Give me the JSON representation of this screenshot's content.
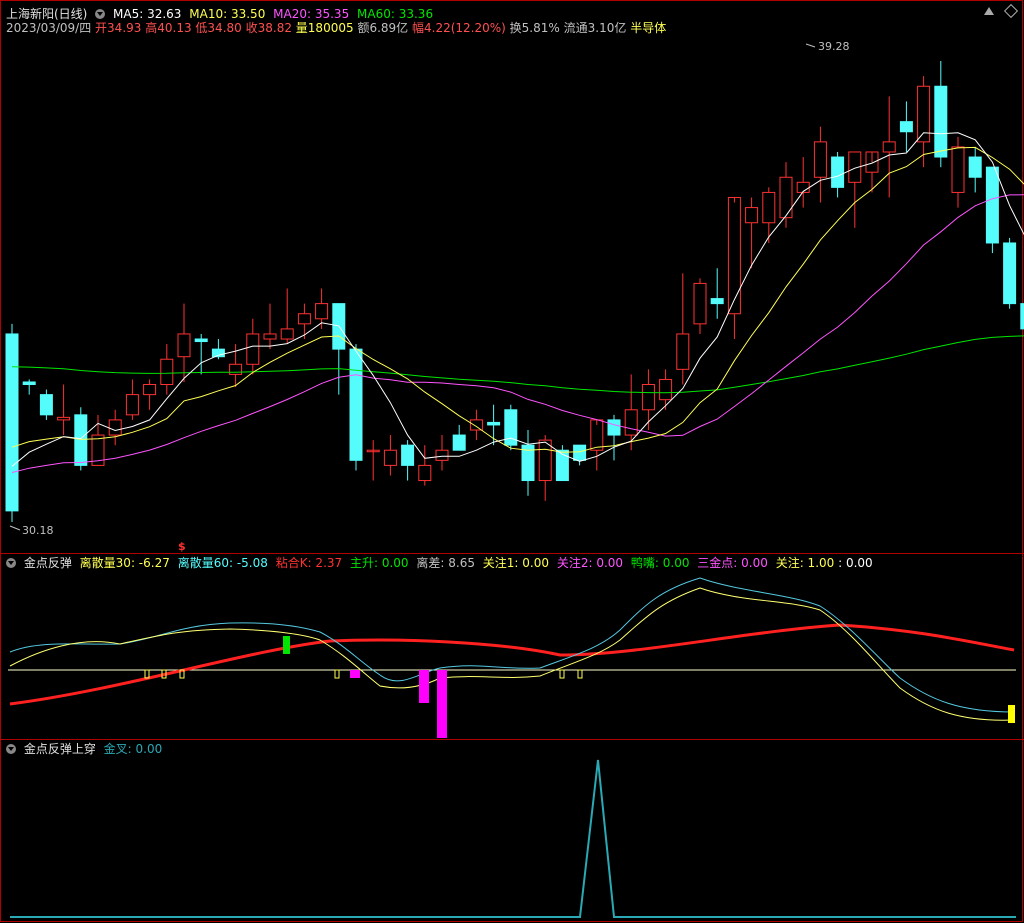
{
  "header": {
    "title": "上海新阳(日线)",
    "ma5": "MA5: 32.63",
    "ma10": "MA10: 33.50",
    "ma20": "MA20: 35.35",
    "ma60": "MA60: 33.36",
    "date": "2023/03/09/四",
    "open": "开34.93",
    "high": "高40.13",
    "low": "低34.80",
    "close": "收38.82",
    "volume": "量180005",
    "amount": "额6.89亿",
    "change": "幅4.22(12.20%)",
    "turnover": "换5.81%",
    "float": "流通3.10亿",
    "sector": "半导体"
  },
  "panel2": {
    "title": "金点反弹",
    "items": [
      "离散量30: -6.27",
      "离散量60: -5.08",
      "粘合K: 2.37",
      "主升: 0.00",
      "离差: 8.65",
      "关注1: 0.00",
      "关注2: 0.00",
      "鸭嘴: 0.00",
      "三金点: 0.00",
      "关注: 1.00",
      ": 0.00"
    ]
  },
  "panel3": {
    "title": "金点反弹上穿",
    "item": "金叉: 0.00"
  },
  "markers": {
    "high_label": "39.28",
    "low_label": "30.18",
    "signal": "$"
  },
  "colors": {
    "up": "#ff3232",
    "down": "#54fcfc",
    "ma5": "#ffffff",
    "ma10": "#ffff54",
    "ma20": "#ff54ff",
    "ma60": "#00e600",
    "border": "#b00000"
  },
  "chart_data": {
    "type": "candlestick",
    "price_range": [
      30.18,
      39.28
    ],
    "candles": [
      {
        "o": 33.9,
        "h": 34.1,
        "l": 30.18,
        "c": 30.4
      },
      {
        "o": 32.95,
        "h": 33.0,
        "l": 32.7,
        "c": 32.9
      },
      {
        "o": 32.7,
        "h": 32.8,
        "l": 32.2,
        "c": 32.3
      },
      {
        "o": 32.2,
        "h": 32.9,
        "l": 31.9,
        "c": 32.25
      },
      {
        "o": 32.3,
        "h": 32.45,
        "l": 31.2,
        "c": 31.3
      },
      {
        "o": 31.3,
        "h": 32.3,
        "l": 31.3,
        "c": 31.9
      },
      {
        "o": 31.9,
        "h": 32.4,
        "l": 31.7,
        "c": 32.2
      },
      {
        "o": 32.3,
        "h": 33.0,
        "l": 32.2,
        "c": 32.7
      },
      {
        "o": 32.7,
        "h": 33.0,
        "l": 32.4,
        "c": 32.9
      },
      {
        "o": 32.9,
        "h": 33.7,
        "l": 32.7,
        "c": 33.4
      },
      {
        "o": 33.45,
        "h": 34.5,
        "l": 32.95,
        "c": 33.9
      },
      {
        "o": 33.8,
        "h": 33.9,
        "l": 33.1,
        "c": 33.75
      },
      {
        "o": 33.6,
        "h": 33.8,
        "l": 33.4,
        "c": 33.45
      },
      {
        "o": 33.1,
        "h": 33.7,
        "l": 32.85,
        "c": 33.3
      },
      {
        "o": 33.3,
        "h": 34.2,
        "l": 33.1,
        "c": 33.9
      },
      {
        "o": 33.8,
        "h": 34.5,
        "l": 33.6,
        "c": 33.9
      },
      {
        "o": 33.8,
        "h": 34.8,
        "l": 33.7,
        "c": 34.0
      },
      {
        "o": 34.1,
        "h": 34.5,
        "l": 33.8,
        "c": 34.3
      },
      {
        "o": 34.2,
        "h": 34.8,
        "l": 34.0,
        "c": 34.5
      },
      {
        "o": 34.5,
        "h": 34.1,
        "l": 32.7,
        "c": 33.6
      },
      {
        "o": 33.6,
        "h": 33.7,
        "l": 31.2,
        "c": 31.4
      },
      {
        "o": 31.6,
        "h": 31.8,
        "l": 31.0,
        "c": 31.6
      },
      {
        "o": 31.3,
        "h": 31.9,
        "l": 31.1,
        "c": 31.6
      },
      {
        "o": 31.7,
        "h": 31.8,
        "l": 31.0,
        "c": 31.3
      },
      {
        "o": 31.0,
        "h": 31.7,
        "l": 30.9,
        "c": 31.3
      },
      {
        "o": 31.4,
        "h": 31.9,
        "l": 31.2,
        "c": 31.6
      },
      {
        "o": 31.9,
        "h": 32.1,
        "l": 31.6,
        "c": 31.6
      },
      {
        "o": 32.0,
        "h": 32.4,
        "l": 31.8,
        "c": 32.2
      },
      {
        "o": 32.15,
        "h": 32.5,
        "l": 31.7,
        "c": 32.1
      },
      {
        "o": 32.4,
        "h": 32.5,
        "l": 31.6,
        "c": 31.7
      },
      {
        "o": 31.7,
        "h": 32.0,
        "l": 30.7,
        "c": 31.0
      },
      {
        "o": 31.0,
        "h": 31.9,
        "l": 30.6,
        "c": 31.8
      },
      {
        "o": 31.6,
        "h": 31.7,
        "l": 31.0,
        "c": 31.0
      },
      {
        "o": 31.7,
        "h": 31.7,
        "l": 31.3,
        "c": 31.4
      },
      {
        "o": 31.6,
        "h": 32.1,
        "l": 31.2,
        "c": 32.2
      },
      {
        "o": 32.2,
        "h": 32.3,
        "l": 31.4,
        "c": 31.9
      },
      {
        "o": 31.9,
        "h": 33.1,
        "l": 31.6,
        "c": 32.4
      },
      {
        "o": 32.4,
        "h": 33.2,
        "l": 32.0,
        "c": 32.9
      },
      {
        "o": 32.6,
        "h": 33.2,
        "l": 32.4,
        "c": 33.0
      },
      {
        "o": 33.2,
        "h": 35.1,
        "l": 32.9,
        "c": 33.9
      },
      {
        "o": 34.1,
        "h": 35.0,
        "l": 33.9,
        "c": 34.9
      },
      {
        "o": 34.6,
        "h": 35.2,
        "l": 34.2,
        "c": 34.5
      },
      {
        "o": 34.3,
        "h": 36.5,
        "l": 33.8,
        "c": 36.6
      },
      {
        "o": 36.1,
        "h": 36.6,
        "l": 35.2,
        "c": 36.4
      },
      {
        "o": 36.1,
        "h": 36.8,
        "l": 35.7,
        "c": 36.7
      },
      {
        "o": 36.2,
        "h": 37.3,
        "l": 36.0,
        "c": 37.0
      },
      {
        "o": 36.7,
        "h": 37.4,
        "l": 36.4,
        "c": 36.9
      },
      {
        "o": 37.0,
        "h": 38.0,
        "l": 36.5,
        "c": 37.7
      },
      {
        "o": 37.4,
        "h": 37.5,
        "l": 36.6,
        "c": 36.8
      },
      {
        "o": 36.9,
        "h": 37.5,
        "l": 36.0,
        "c": 37.5
      },
      {
        "o": 37.1,
        "h": 37.3,
        "l": 36.7,
        "c": 37.5
      },
      {
        "o": 37.5,
        "h": 38.6,
        "l": 36.6,
        "c": 37.7
      },
      {
        "o": 38.1,
        "h": 38.5,
        "l": 37.5,
        "c": 37.9
      },
      {
        "o": 37.7,
        "h": 39.0,
        "l": 37.2,
        "c": 38.8
      },
      {
        "o": 38.8,
        "h": 39.3,
        "l": 37.2,
        "c": 37.4
      },
      {
        "o": 36.7,
        "h": 37.8,
        "l": 36.4,
        "c": 37.6
      },
      {
        "o": 37.4,
        "h": 37.6,
        "l": 36.7,
        "c": 37.0
      },
      {
        "o": 37.2,
        "h": 37.2,
        "l": 35.5,
        "c": 35.7
      },
      {
        "o": 35.7,
        "h": 35.8,
        "l": 34.4,
        "c": 34.5
      },
      {
        "o": 34.5,
        "h": 35.0,
        "l": 34.0,
        "c": 34.0
      },
      {
        "o": 34.0,
        "h": 34.2,
        "l": 33.5,
        "c": 34.0
      },
      {
        "o": 33.5,
        "h": 34.0,
        "l": 33.5,
        "c": 33.45
      },
      {
        "o": 33.2,
        "h": 33.5,
        "l": 32.0,
        "c": 32.5
      },
      {
        "o": 32.4,
        "h": 32.7,
        "l": 31.7,
        "c": 31.9
      },
      {
        "o": 31.7,
        "h": 32.1,
        "l": 31.5,
        "c": 32.4
      },
      {
        "o": 32.4,
        "h": 32.8,
        "l": 31.8,
        "c": 32.6
      },
      {
        "o": 32.2,
        "h": 33.0,
        "l": 32.0,
        "c": 32.9
      },
      {
        "o": 32.6,
        "h": 32.9,
        "l": 32.2,
        "c": 32.5
      }
    ]
  }
}
